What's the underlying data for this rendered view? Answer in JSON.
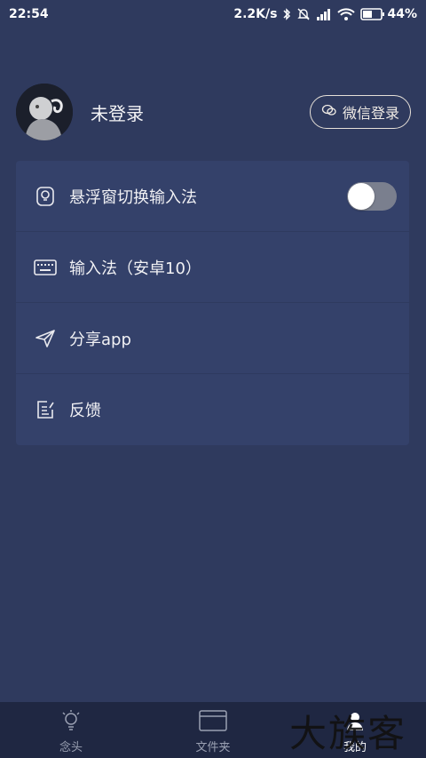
{
  "status_bar": {
    "time": "22:54",
    "speed": "2.2K/s",
    "battery": "44%"
  },
  "profile": {
    "name": "未登录",
    "login_button": "微信登录"
  },
  "menu": {
    "items": [
      {
        "label": "悬浮窗切换输入法",
        "icon": "lightbulb-icon"
      },
      {
        "label": "输入法（安卓10）",
        "icon": "keyboard-icon"
      },
      {
        "label": "分享app",
        "icon": "send-icon"
      },
      {
        "label": "反馈",
        "icon": "edit-icon"
      }
    ],
    "toggle_on": false
  },
  "bottom_nav": {
    "items": [
      {
        "label": "念头",
        "icon": "bulb-icon"
      },
      {
        "label": "文件夹",
        "icon": "folder-icon"
      },
      {
        "label": "我的",
        "icon": "user-icon"
      }
    ],
    "active": 2
  },
  "watermark": "大族客",
  "colors": {
    "background": "#2f3a5e",
    "card": "#34416a",
    "nav": "#1f2742"
  }
}
